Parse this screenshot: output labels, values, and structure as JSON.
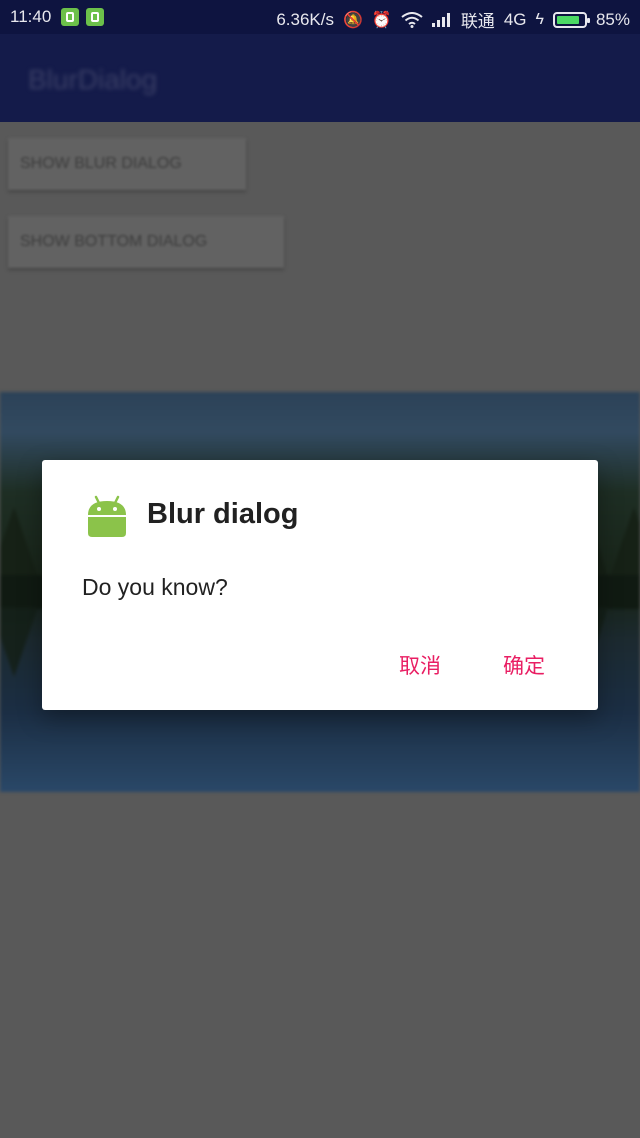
{
  "status_bar": {
    "time": "11:40",
    "net_speed": "6.36K/s",
    "carrier": "联通",
    "network": "4G",
    "battery": "85%",
    "battery_level": 0.85,
    "icons": [
      "sim-icon",
      "cat-icon",
      "silent-bell-icon",
      "alarm-icon",
      "wifi-icon",
      "signal-icon",
      "charging-icon",
      "battery-icon"
    ]
  },
  "app": {
    "title": "BlurDialog",
    "buttons": [
      "SHOW BLUR DIALOG",
      "SHOW BOTTOM DIALOG"
    ]
  },
  "dialog": {
    "title": "Blur dialog",
    "message": "Do you know?",
    "cancel_label": "取消",
    "ok_label": "确定"
  },
  "colors": {
    "status_bar": "#0e1440",
    "app_bar": "#141b4a",
    "accent": "#e91e63",
    "android_green": "#8bc34a",
    "battery_green": "#4cd964"
  }
}
